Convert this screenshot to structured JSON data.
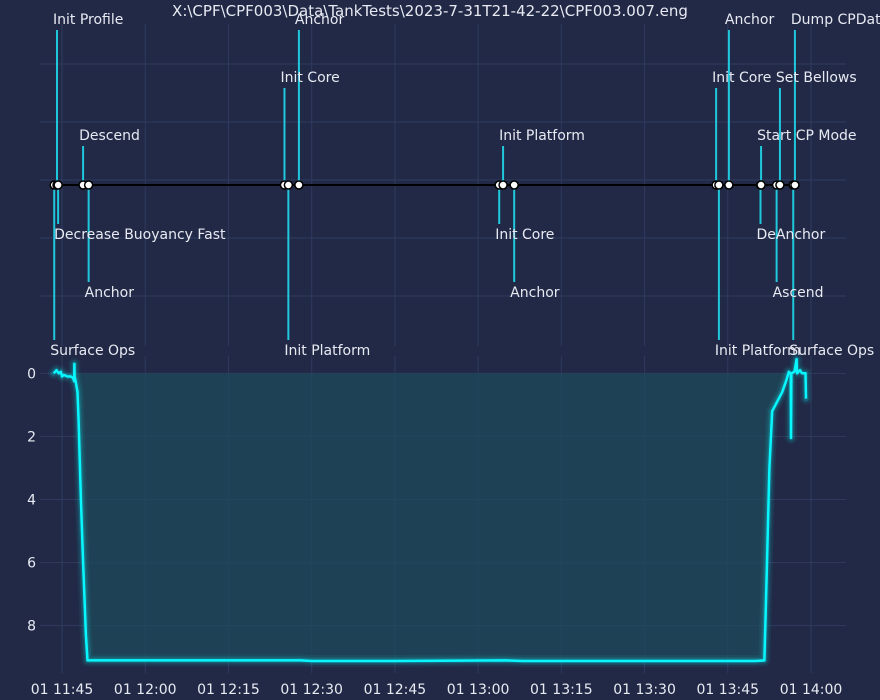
{
  "chart_data": [
    {
      "type": "timeline",
      "title": "X:\\CPF\\CPF003\\Data\\TankTests\\2023-7-31T21-42-22\\CPF003.007.eng",
      "events": [
        {
          "t": "11:43:36",
          "label": "Surface Ops"
        },
        {
          "t": "11:44:06",
          "label": "Init Profile"
        },
        {
          "t": "11:44:18",
          "label": "Decrease Buoyancy Fast"
        },
        {
          "t": "11:48:48",
          "label": "Descend"
        },
        {
          "t": "11:49:48",
          "label": "Anchor"
        },
        {
          "t": "12:25:06",
          "label": "Init Core"
        },
        {
          "t": "12:25:48",
          "label": "Init Platform"
        },
        {
          "t": "12:27:42",
          "label": "Anchor"
        },
        {
          "t": "13:03:48",
          "label": "Init Core"
        },
        {
          "t": "13:04:30",
          "label": "Init Platform"
        },
        {
          "t": "13:06:30",
          "label": "Anchor"
        },
        {
          "t": "13:42:54",
          "label": "Init Core"
        },
        {
          "t": "13:43:24",
          "label": "Init Platform"
        },
        {
          "t": "13:45:12",
          "label": "Anchor"
        },
        {
          "t": "13:50:54",
          "label": "DeAnchor"
        },
        {
          "t": "13:51:00",
          "label": "Start CP Mode"
        },
        {
          "t": "13:53:48",
          "label": "Ascend"
        },
        {
          "t": "13:54:24",
          "label": "Set Bellows"
        },
        {
          "t": "13:56:48",
          "label": "Surface Ops"
        },
        {
          "t": "13:57:06",
          "label": "Dump CPData"
        }
      ]
    },
    {
      "type": "area",
      "x_ticks": [
        "01 11:45",
        "01 12:00",
        "01 12:15",
        "01 12:30",
        "01 12:45",
        "01 13:00",
        "01 13:15",
        "01 13:30",
        "01 13:45",
        "01 14:00"
      ],
      "y_ticks": [
        "0",
        "2",
        "4",
        "6",
        "8"
      ],
      "ylim": [
        -0.55,
        9.5
      ],
      "y_inverted": true,
      "series": [
        {
          "points": [
            [
              "11:43:30",
              0.0
            ],
            [
              "11:44:00",
              -0.1
            ],
            [
              "11:44:24",
              0.0
            ],
            [
              "11:44:48",
              -0.05
            ],
            [
              "11:45:00",
              0.1
            ],
            [
              "11:45:18",
              0.05
            ],
            [
              "11:46:00",
              0.1
            ],
            [
              "11:46:36",
              0.1
            ],
            [
              "11:47:00",
              0.15
            ],
            [
              "11:47:12",
              0.25
            ],
            [
              "11:47:14",
              -0.3
            ],
            [
              "11:47:16",
              0.1
            ],
            [
              "11:47:30",
              0.3
            ],
            [
              "11:47:48",
              0.6
            ],
            [
              "11:48:00",
              1.5
            ],
            [
              "11:48:24",
              4.0
            ],
            [
              "11:48:48",
              6.0
            ],
            [
              "11:49:18",
              8.3
            ],
            [
              "11:49:36",
              9.1
            ],
            [
              "12:00:00",
              9.1
            ],
            [
              "12:28:00",
              9.1
            ],
            [
              "12:30:00",
              9.12
            ],
            [
              "12:45:00",
              9.12
            ],
            [
              "13:05:00",
              9.1
            ],
            [
              "13:08:00",
              9.12
            ],
            [
              "13:30:00",
              9.12
            ],
            [
              "13:50:00",
              9.12
            ],
            [
              "13:51:36",
              9.1
            ],
            [
              "13:52:00",
              6.5
            ],
            [
              "13:52:30",
              3.0
            ],
            [
              "13:53:00",
              1.2
            ],
            [
              "13:54:48",
              0.6
            ],
            [
              "13:55:36",
              0.2
            ],
            [
              "13:56:00",
              -0.05
            ],
            [
              "13:56:20",
              0.0
            ],
            [
              "13:56:24",
              2.05
            ],
            [
              "13:56:28",
              0.0
            ],
            [
              "13:57:00",
              -0.05
            ],
            [
              "13:57:24",
              -0.45
            ],
            [
              "13:57:30",
              0.0
            ],
            [
              "13:58:00",
              -0.1
            ],
            [
              "13:58:24",
              0.0
            ],
            [
              "13:59:00",
              0.0
            ],
            [
              "13:59:06",
              0.8
            ]
          ]
        }
      ]
    }
  ],
  "colors": {
    "background": "#212946",
    "grid": "#2f3a5e",
    "line": "#08F7FE",
    "fill": "#1f4a5c",
    "stem": "#1fc8dc",
    "text": "#e8eaf2"
  }
}
